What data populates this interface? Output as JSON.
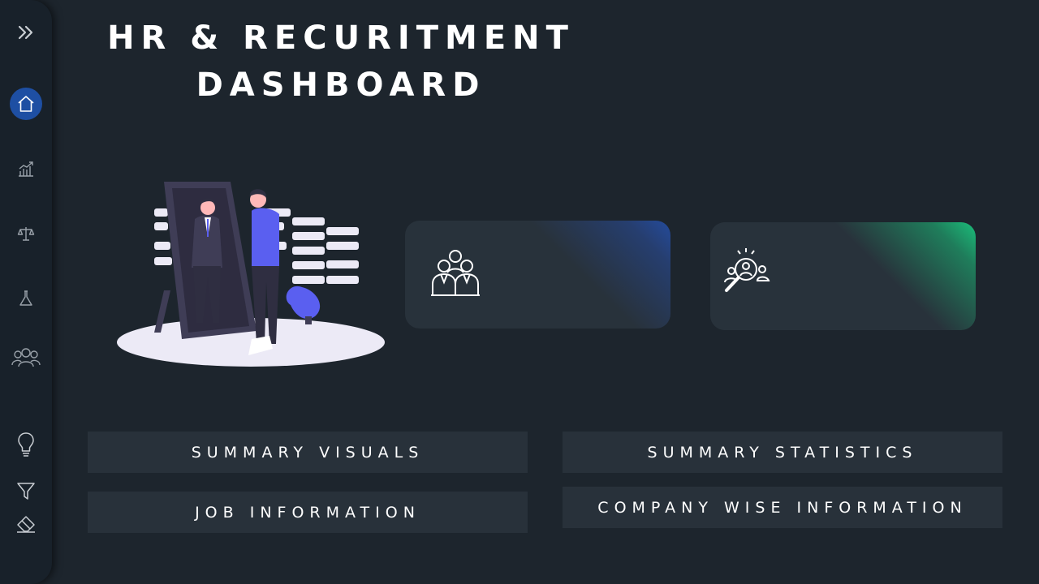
{
  "header": {
    "title_line1": "HR & RECURITMENT",
    "title_line2": "DASHBOARD"
  },
  "sidebar": {
    "items": [
      {
        "icon": "chevron-double-right-icon"
      },
      {
        "icon": "home-icon",
        "active": true
      },
      {
        "icon": "chart-icon"
      },
      {
        "icon": "scales-icon"
      },
      {
        "icon": "flask-icon"
      },
      {
        "icon": "people-group-icon"
      },
      {
        "icon": "lightbulb-icon"
      },
      {
        "icon": "filter-icon"
      },
      {
        "icon": "eraser-icon"
      }
    ]
  },
  "cards": [
    {
      "icon": "team-icon",
      "accent": "#244b9c"
    },
    {
      "icon": "candidate-search-icon",
      "accent": "#1bbd7a"
    }
  ],
  "nav_buttons": {
    "summary_visuals": "SUMMARY VISUALS",
    "summary_statistics": "SUMMARY STATISTICS",
    "job_information": "JOB INFORMATION",
    "company_wise_information": "COMPANY WISE INFORMATION"
  },
  "colors": {
    "background": "#1d252d",
    "sidebar": "#18212a",
    "card": "#28323b",
    "button": "#28313a",
    "active": "#1e4fa3",
    "illustration_accent": "#5a5ff0"
  }
}
